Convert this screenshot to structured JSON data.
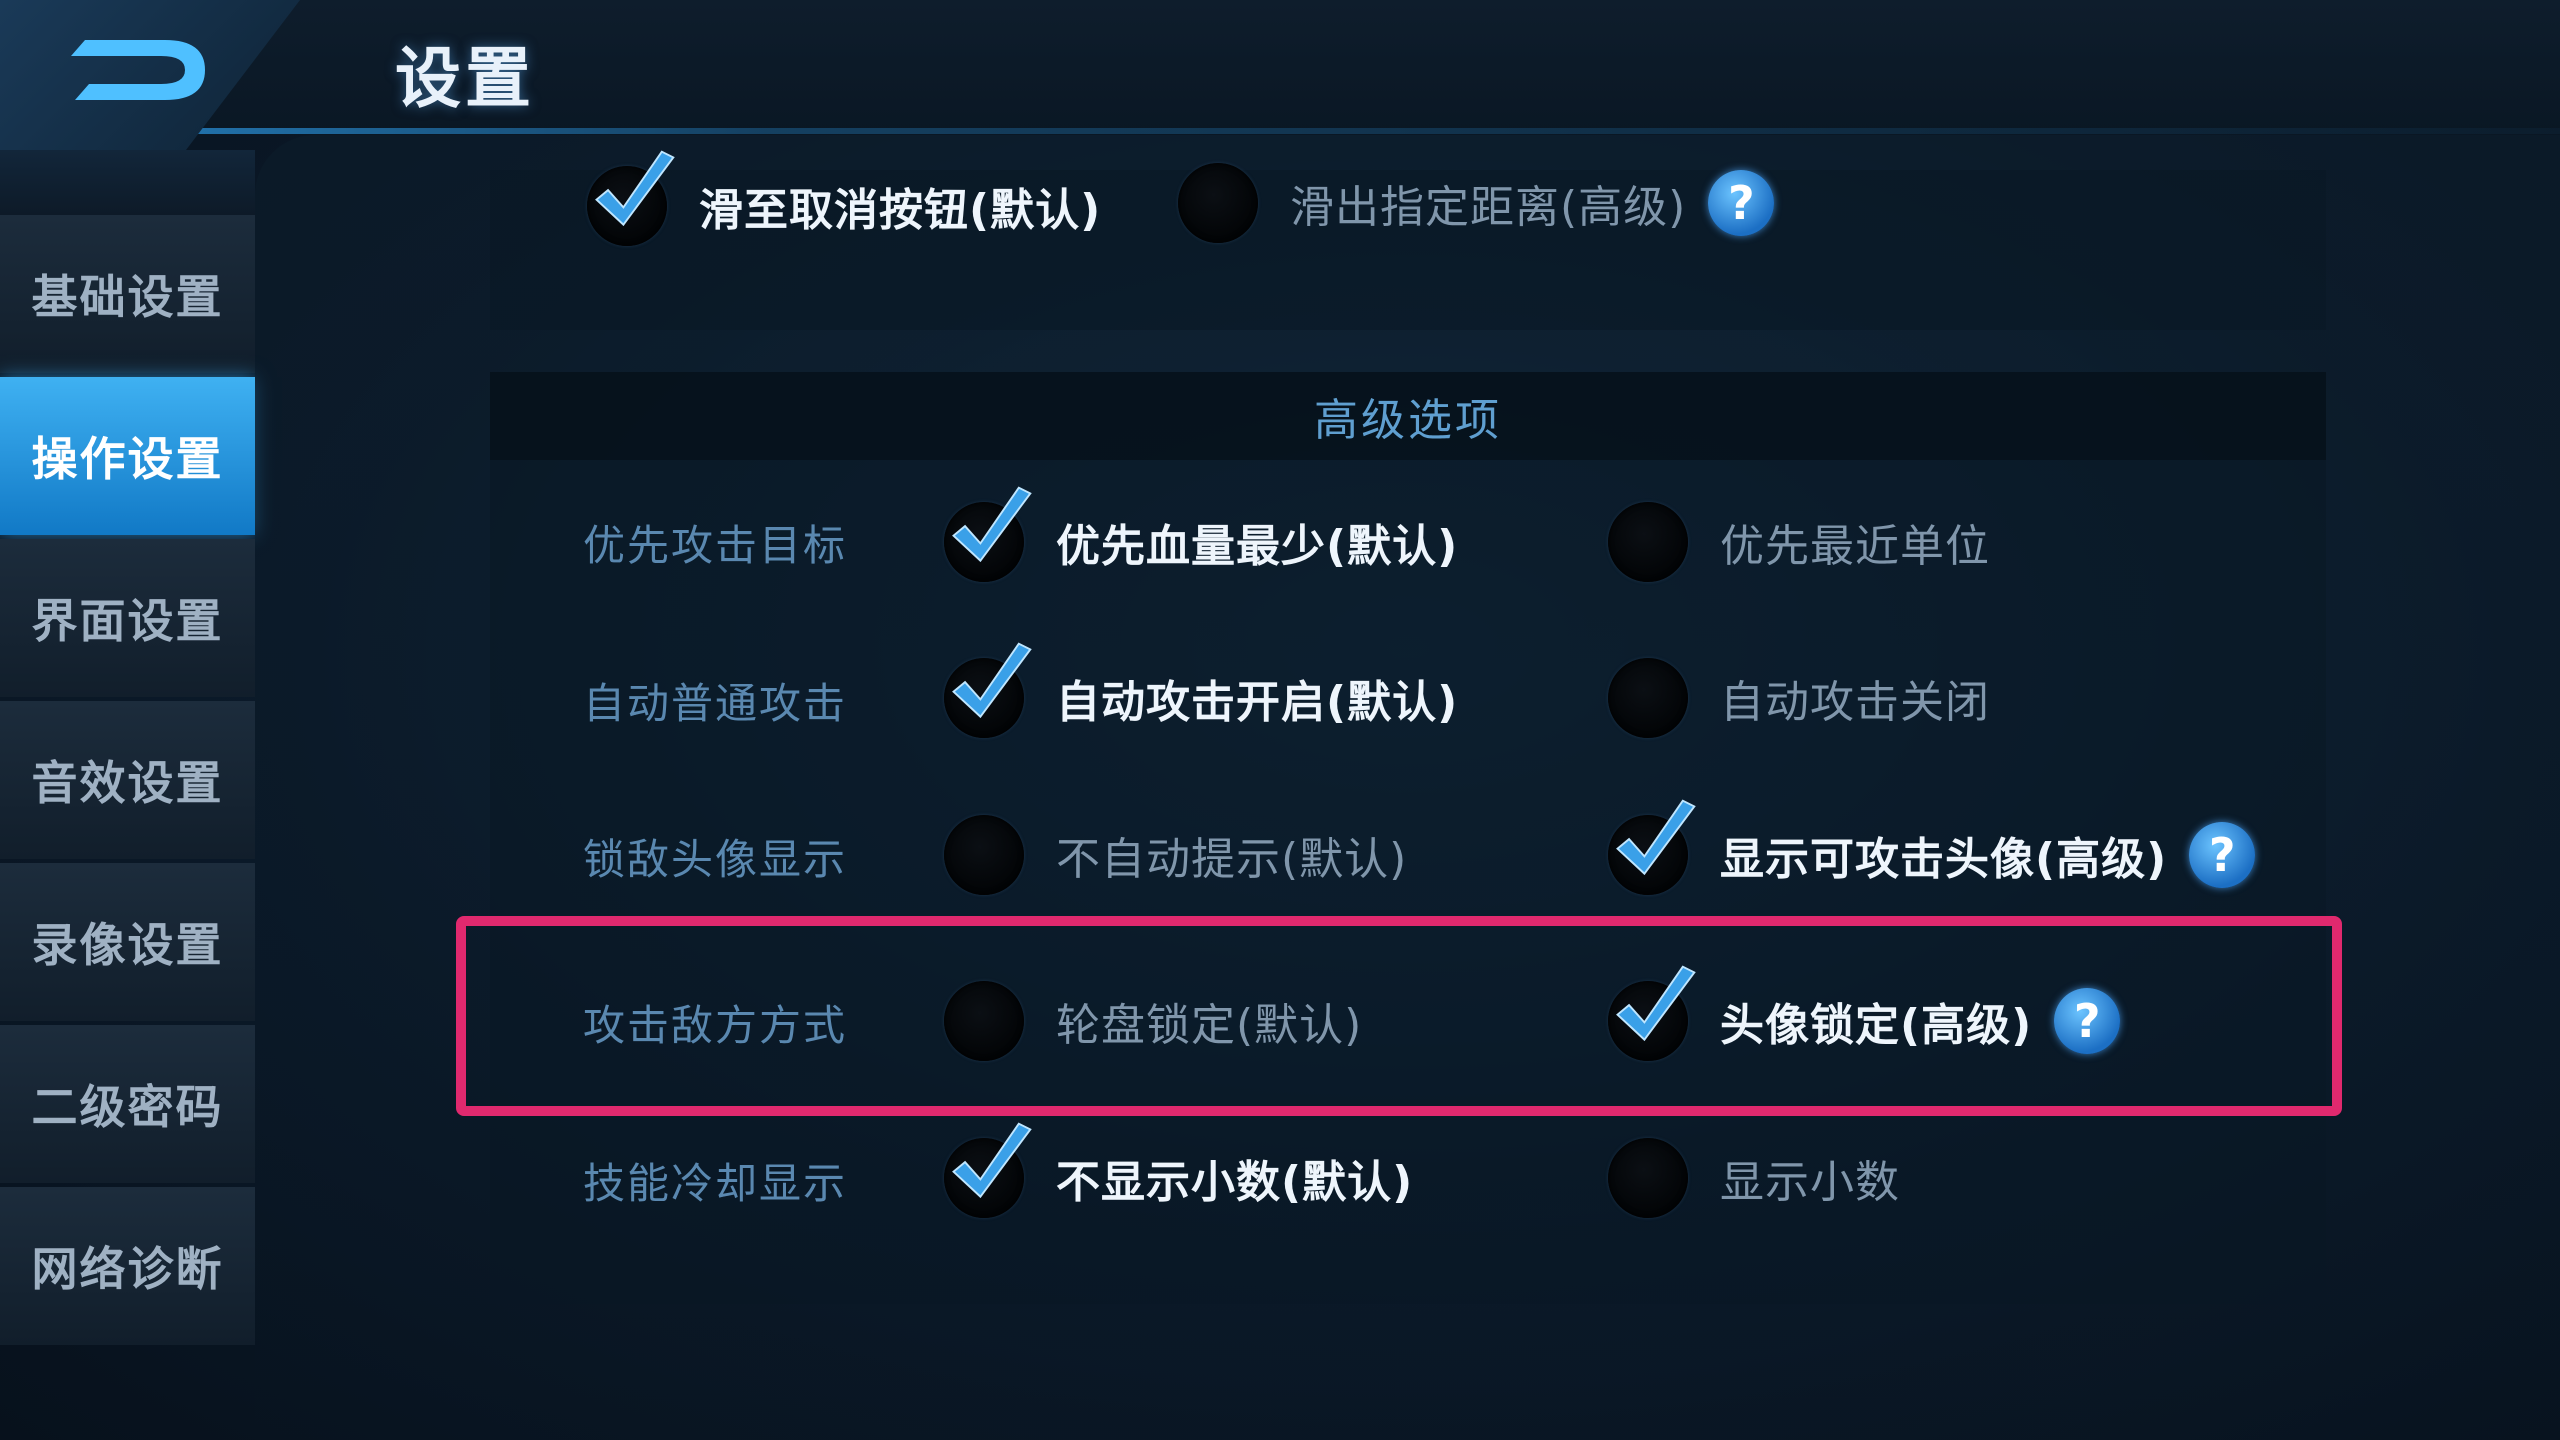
{
  "header": {
    "title": "设置"
  },
  "sidebar": {
    "items": [
      {
        "label": "基础设置",
        "active": false
      },
      {
        "label": "操作设置",
        "active": true
      },
      {
        "label": "界面设置",
        "active": false
      },
      {
        "label": "音效设置",
        "active": false
      },
      {
        "label": "录像设置",
        "active": false
      },
      {
        "label": "二级密码",
        "active": false
      },
      {
        "label": "网络诊断",
        "active": false
      }
    ]
  },
  "top_row": {
    "opt1": {
      "label": "滑至取消按钮(默认)",
      "checked": true
    },
    "opt2": {
      "label": "滑出指定距离(高级)",
      "checked": false,
      "help": "?"
    }
  },
  "advanced": {
    "title": "高级选项",
    "rows": [
      {
        "label": "优先攻击目标",
        "opt1": {
          "label": "优先血量最少(默认)",
          "checked": true
        },
        "opt2": {
          "label": "优先最近单位",
          "checked": false
        }
      },
      {
        "label": "自动普通攻击",
        "opt1": {
          "label": "自动攻击开启(默认)",
          "checked": true
        },
        "opt2": {
          "label": "自动攻击关闭",
          "checked": false
        }
      },
      {
        "label": "锁敌头像显示",
        "opt1": {
          "label": "不自动提示(默认)",
          "checked": false
        },
        "opt2": {
          "label": "显示可攻击头像(高级)",
          "checked": true,
          "help": "?"
        }
      },
      {
        "label": "攻击敌方方式",
        "opt1": {
          "label": "轮盘锁定(默认)",
          "checked": false
        },
        "opt2": {
          "label": "头像锁定(高级)",
          "checked": true,
          "help": "?"
        }
      },
      {
        "label": "技能冷却显示",
        "opt1": {
          "label": "不显示小数(默认)",
          "checked": true
        },
        "opt2": {
          "label": "显示小数",
          "checked": false
        }
      }
    ]
  },
  "colors": {
    "accent": "#3fb1f2",
    "highlight": "#e0296e",
    "check": "#3aa0e8"
  }
}
